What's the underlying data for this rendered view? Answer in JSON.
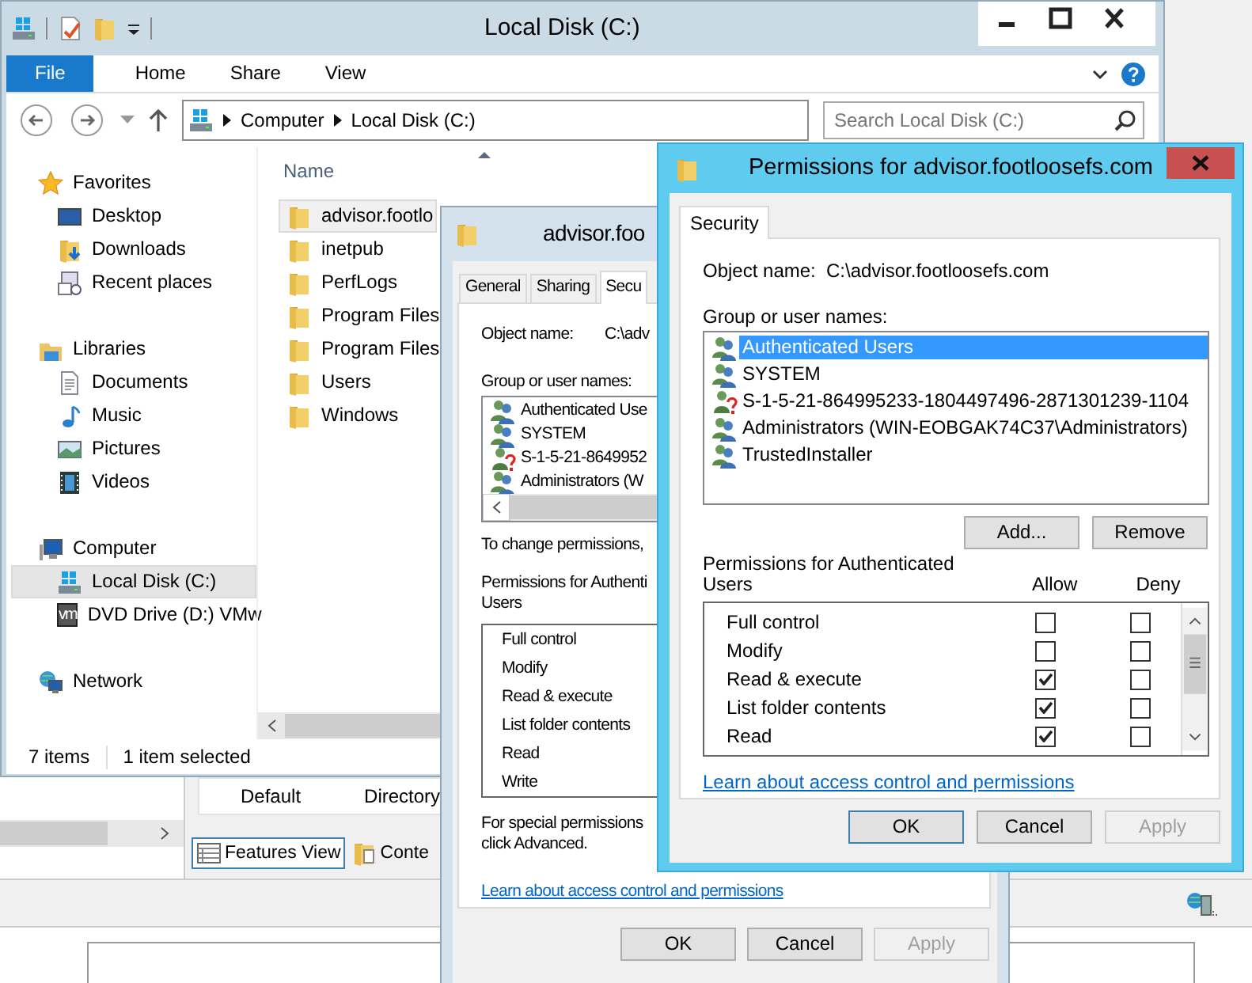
{
  "explorer": {
    "title": "Local Disk (C:)",
    "ribbon_tabs": [
      {
        "label": "File",
        "selected": true
      },
      {
        "label": "Home",
        "selected": false
      },
      {
        "label": "Share",
        "selected": false
      },
      {
        "label": "View",
        "selected": false
      }
    ],
    "address": [
      "Computer",
      "Local Disk (C:)"
    ],
    "search": {
      "placeholder": "Search Local Disk (C:)"
    },
    "nav": [
      {
        "label": "Favorites",
        "selected": false,
        "children": [
          {
            "label": "Desktop",
            "selected": false
          },
          {
            "label": "Downloads",
            "selected": false
          },
          {
            "label": "Recent places",
            "selected": false
          }
        ]
      },
      {
        "label": "Libraries",
        "selected": false,
        "children": [
          {
            "label": "Documents",
            "selected": false
          },
          {
            "label": "Music",
            "selected": false
          },
          {
            "label": "Pictures",
            "selected": false
          },
          {
            "label": "Videos",
            "selected": false
          }
        ]
      },
      {
        "label": "Computer",
        "selected": false,
        "children": [
          {
            "label": "Local Disk (C:)",
            "selected": true
          },
          {
            "label": "DVD Drive (D:) VMw",
            "badge": "vm",
            "selected": false
          }
        ]
      },
      {
        "label": "Network",
        "selected": false
      }
    ],
    "column": "Name",
    "files": [
      {
        "name": "advisor.footlo",
        "selected": true
      },
      {
        "name": "inetpub",
        "selected": false
      },
      {
        "name": "PerfLogs",
        "selected": false
      },
      {
        "name": "Program Files",
        "selected": false
      },
      {
        "name": "Program Files",
        "selected": false
      },
      {
        "name": "Users",
        "selected": false
      },
      {
        "name": "Windows",
        "selected": false
      }
    ],
    "status": [
      "7 items",
      "1 item selected"
    ]
  },
  "iis": {
    "cells": [
      "Default",
      "Directory"
    ],
    "view_tabs": [
      {
        "label": "Features View",
        "selected": true
      },
      {
        "label": "Conte",
        "selected": false
      }
    ]
  },
  "properties": {
    "title": "advisor.foo",
    "tabs": [
      {
        "label": "General",
        "selected": false
      },
      {
        "label": "Sharing",
        "selected": false
      },
      {
        "label": "Secu",
        "selected": true
      }
    ],
    "object_label": "Object name:",
    "object_value": "C:\\adv",
    "group_label": "Group or user names:",
    "users": [
      {
        "name": "Authenticated Use",
        "kind": "group",
        "selected": false
      },
      {
        "name": "SYSTEM",
        "kind": "group",
        "selected": false
      },
      {
        "name": "S-1-5-21-8649952",
        "kind": "unresolved",
        "selected": false
      },
      {
        "name": "Administrators (W",
        "kind": "group",
        "selected": false
      }
    ],
    "change_text": "To change permissions,",
    "perm_label_lines": [
      "Permissions for Authenti",
      "Users"
    ],
    "permissions": [
      "Full control",
      "Modify",
      "Read & execute",
      "List folder contents",
      "Read",
      "Write"
    ],
    "special_lines": [
      "For special permissions",
      "click Advanced."
    ],
    "link": "Learn about access control and permissions",
    "buttons": [
      {
        "label": "OK",
        "disabled": false
      },
      {
        "label": "Cancel",
        "disabled": false
      },
      {
        "label": "Apply",
        "disabled": true
      }
    ]
  },
  "permissions_dialog": {
    "title": "Permissions for advisor.footloosefs.com",
    "tabs": [
      {
        "label": "Security",
        "selected": true
      }
    ],
    "object_label": "Object name:",
    "object_value": "C:\\advisor.footloosefs.com",
    "group_label": "Group or user names:",
    "users": [
      {
        "name": "Authenticated Users",
        "kind": "group",
        "selected": true
      },
      {
        "name": "SYSTEM",
        "kind": "group",
        "selected": false
      },
      {
        "name": "S-1-5-21-864995233-1804497496-2871301239-1104",
        "kind": "unresolved",
        "selected": false
      },
      {
        "name": "Administrators (WIN-EOBGAK74C37\\Administrators)",
        "kind": "group",
        "selected": false
      },
      {
        "name": "TrustedInstaller",
        "kind": "group",
        "selected": false
      }
    ],
    "list_buttons": [
      "Add...",
      "Remove"
    ],
    "perm_label": "Permissions for Authenticated Users",
    "allow_label": "Allow",
    "deny_label": "Deny",
    "permissions": [
      {
        "name": "Full control",
        "allow": false,
        "deny": false
      },
      {
        "name": "Modify",
        "allow": false,
        "deny": false
      },
      {
        "name": "Read & execute",
        "allow": true,
        "deny": false
      },
      {
        "name": "List folder contents",
        "allow": true,
        "deny": false
      },
      {
        "name": "Read",
        "allow": true,
        "deny": false
      }
    ],
    "link": "Learn about access control and permissions",
    "buttons": [
      {
        "label": "OK",
        "default": true,
        "disabled": false
      },
      {
        "label": "Cancel",
        "default": false,
        "disabled": false
      },
      {
        "label": "Apply",
        "default": false,
        "disabled": true
      }
    ]
  }
}
